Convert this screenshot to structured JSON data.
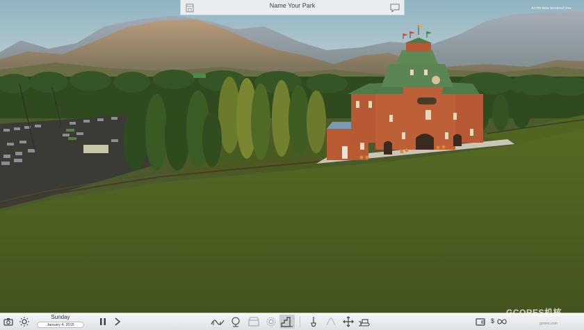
{
  "top_bar": {
    "park_name": "Name Your Park"
  },
  "build_label": "RCTW Beta Weekend One",
  "bottom_bar": {
    "day": "Sunday",
    "date": "January 4, 2015",
    "money_symbol": "$"
  },
  "watermark": {
    "logo": "GCORES机核",
    "url": "gcores.com"
  },
  "icons": [
    "camera-icon",
    "sun-weather-icon",
    "pause-icon",
    "play-speed-icon",
    "coaster-icon",
    "park-management-icon",
    "shop-icon",
    "gear-icon",
    "stairs-terrain-icon",
    "shovel-icon",
    "path-icon",
    "move-icon",
    "bulldozer-icon",
    "wallet-icon",
    "infinity-icon"
  ]
}
